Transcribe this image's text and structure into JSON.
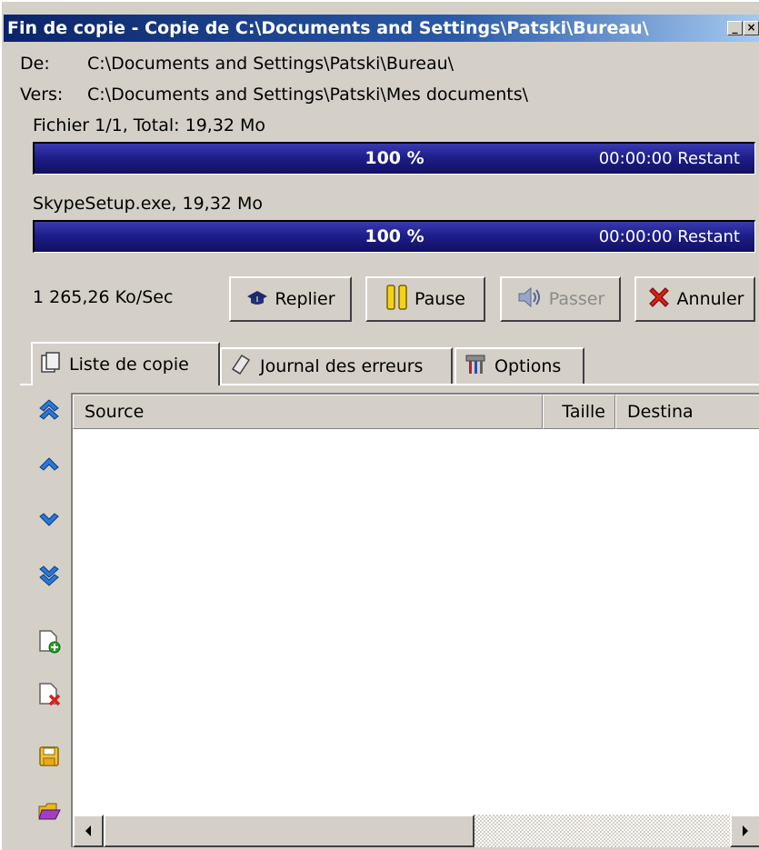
{
  "window": {
    "title": "Fin de copie - Copie de C:\\Documents and Settings\\Patski\\Bureau\\",
    "minimize_glyph": "_",
    "close_glyph": "×"
  },
  "copy_info": {
    "from_label": "De:",
    "from_path": "C:\\Documents and Settings\\Patski\\Bureau\\",
    "to_label": "Vers:",
    "to_path": "C:\\Documents and Settings\\Patski\\Mes documents\\",
    "file_total": "Fichier 1/1, Total: 19,32 Mo",
    "current_file": "SkypeSetup.exe, 19,32 Mo"
  },
  "progress_total": {
    "value": 1.0,
    "percent_text": "100 %",
    "remaining_text": "00:00:00 Restant"
  },
  "progress_file": {
    "value": 1.0,
    "percent_text": "100 %",
    "remaining_text": "00:00:00 Restant"
  },
  "speed": "1 265,26 Ko/Sec",
  "buttons": {
    "fold": "Replier",
    "pause": "Pause",
    "skip": "Passer",
    "cancel": "Annuler"
  },
  "tabs": [
    {
      "label": "Liste de copie",
      "icon": "copy-list-icon",
      "active": true
    },
    {
      "label": "Journal des erreurs",
      "icon": "error-log-icon",
      "active": false
    },
    {
      "label": "Options",
      "icon": "tools-icon",
      "active": false
    }
  ],
  "toolbar_icons": [
    "move-to-top-icon",
    "move-up-icon",
    "move-down-icon",
    "move-to-bottom-icon",
    "add-file-icon",
    "remove-file-icon",
    "save-icon",
    "open-folder-icon"
  ],
  "list": {
    "columns": [
      "Source",
      "Taille",
      "Destina"
    ],
    "rows": []
  },
  "colors": {
    "title_bar": "#0a246a",
    "progress": "#1e1e8c",
    "face": "#d4d0c8"
  }
}
